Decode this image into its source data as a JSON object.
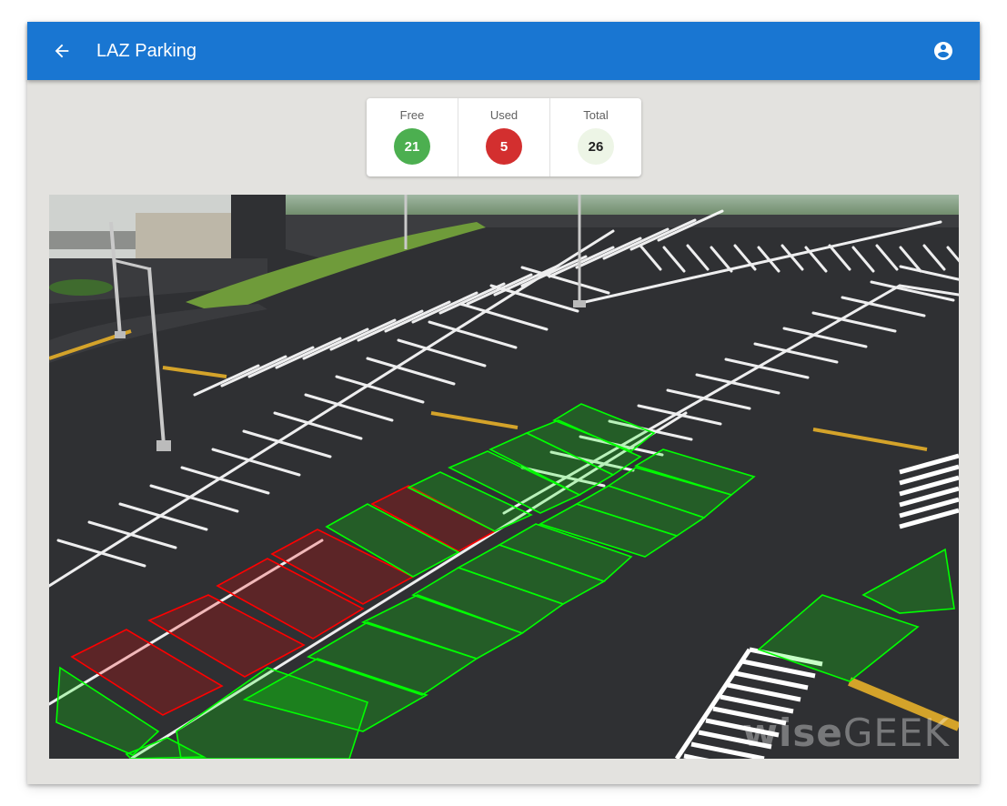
{
  "appbar": {
    "title": "LAZ Parking",
    "back_icon": "arrow-back-icon",
    "account_icon": "account-circle-icon"
  },
  "stats": {
    "free": {
      "label": "Free",
      "value": "21",
      "color": "#4caf50",
      "text_color": "#ffffff"
    },
    "used": {
      "label": "Used",
      "value": "5",
      "color": "#d32f2f",
      "text_color": "#ffffff"
    },
    "total": {
      "label": "Total",
      "value": "26",
      "color": "#edf5e6",
      "text_color": "#212121"
    }
  },
  "colors": {
    "appbar": "#1976d2",
    "free_spot": "#00ff00",
    "used_spot": "#ff0000",
    "asphalt": "#2f3033"
  },
  "lot": {
    "watermark_bold": "wise",
    "watermark_rest": "GEEK",
    "spot_statuses": [
      "free",
      "used",
      "used",
      "used",
      "used",
      "used",
      "free",
      "free",
      "free",
      "free",
      "free",
      "free",
      "free",
      "free",
      "free",
      "free",
      "free",
      "free",
      "free",
      "free",
      "free",
      "free",
      "free",
      "free",
      "free",
      "free"
    ]
  }
}
